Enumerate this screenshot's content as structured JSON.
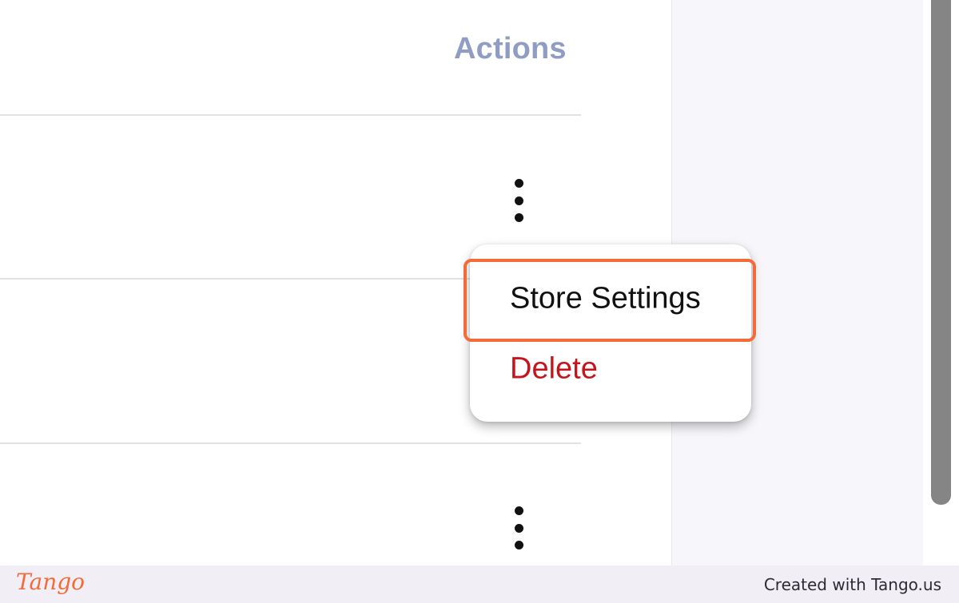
{
  "table": {
    "header_actions": "Actions"
  },
  "menu": {
    "items": [
      {
        "label": "Store Settings",
        "highlighted": true
      },
      {
        "label": "Delete",
        "color": "#c4151c"
      }
    ]
  },
  "footer": {
    "logo_text": "Tango",
    "credit": "Created with Tango.us"
  },
  "colors": {
    "header": "#8f9cc3",
    "highlight": "#f26b3a",
    "delete": "#c4151c",
    "scrollbar": "#858585"
  },
  "icons": {
    "row_action": "more-vert-icon"
  }
}
